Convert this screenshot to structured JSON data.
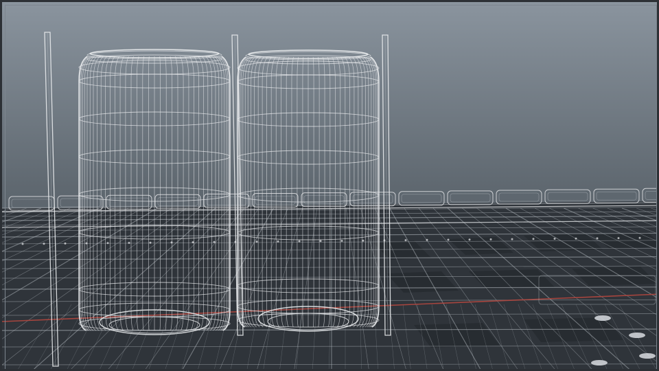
{
  "viewport": {
    "view_mode": "wireframe",
    "colors": {
      "background_top": "#8a949e",
      "background_bottom": "#4c545c",
      "wire": "#e8eaec",
      "wire_dim": "#b7bdc3",
      "floor_dark": "#2f343a",
      "floor_panel": "#3a4047",
      "x_axis": "#b4473f",
      "frame": "#7d868f"
    },
    "objects": [
      {
        "name": "can",
        "count": 2
      },
      {
        "name": "vertical-pole",
        "count": 3
      },
      {
        "name": "conveyor-rail",
        "count": 1
      }
    ]
  }
}
